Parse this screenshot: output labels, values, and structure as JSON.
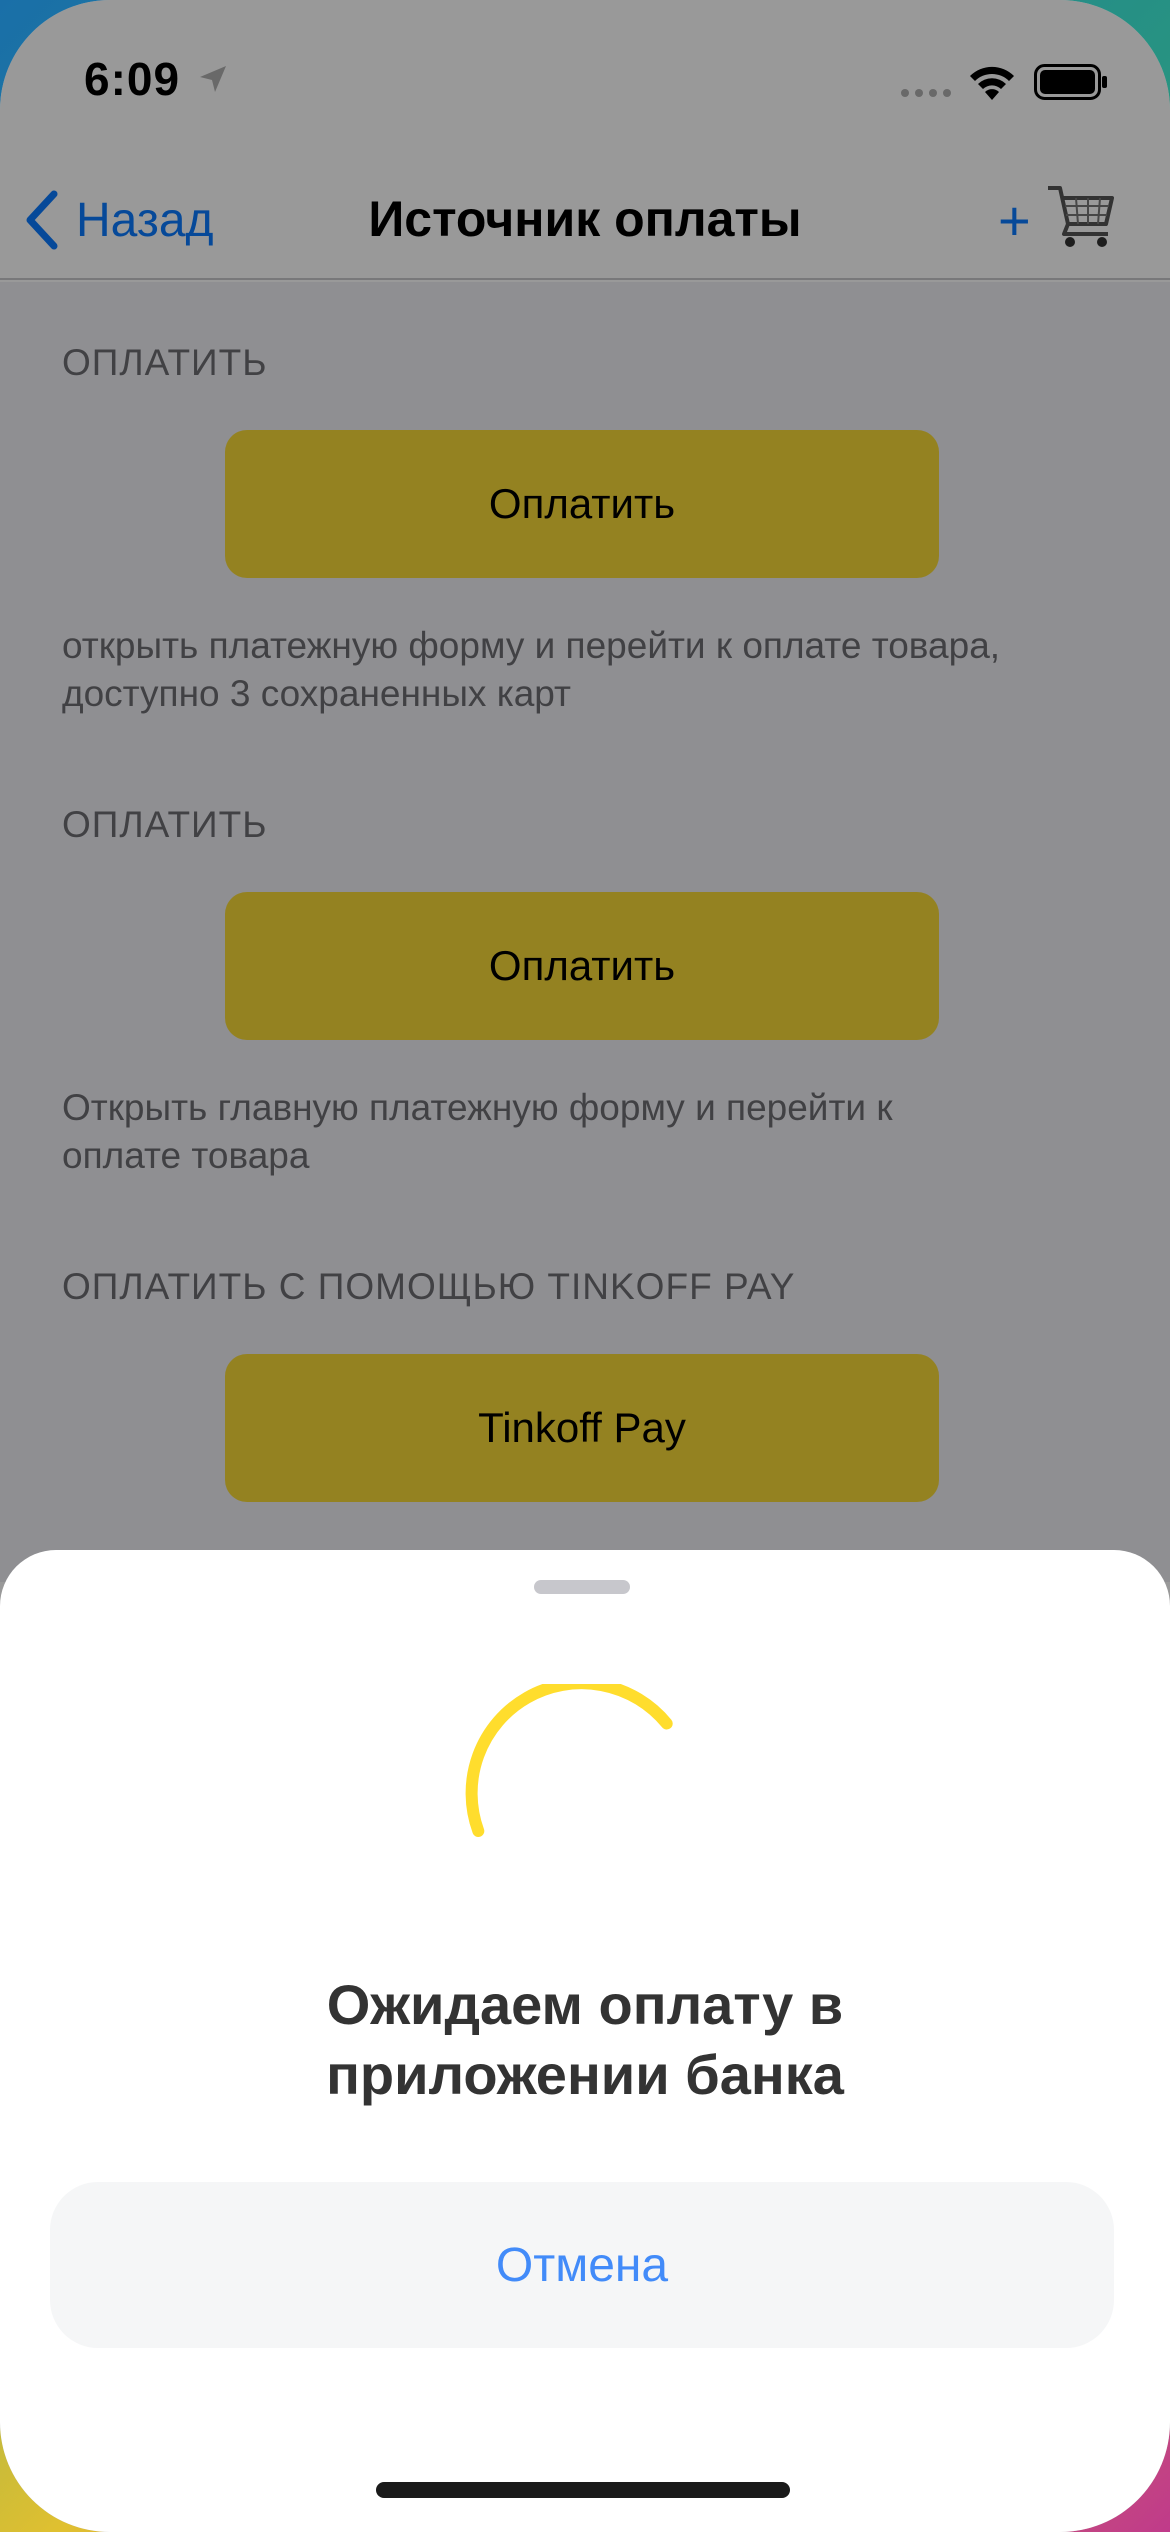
{
  "status_bar": {
    "time": "6:09"
  },
  "nav": {
    "back_label": "Назад",
    "title": "Источник оплаты",
    "plus_label": "+"
  },
  "sections": [
    {
      "header": "ОПЛАТИТЬ",
      "button_label": "Оплатить",
      "footer_line1": "открыть платежную форму и перейти к оплате товара,",
      "footer_line2": "доступно 3 сохраненных карт"
    },
    {
      "header": "ОПЛАТИТЬ",
      "button_label": "Оплатить",
      "footer_line1": "Открыть главную платежную форму и перейти к",
      "footer_line2": "оплате товара"
    },
    {
      "header": "ОПЛАТИТЬ С ПОМОЩЬЮ TINKOFF PAY",
      "button_label": "Tinkoff Pay"
    }
  ],
  "sheet": {
    "title_line1": "Ожидаем оплату в",
    "title_line2": "приложении банка",
    "cancel_label": "Отмена"
  },
  "colors": {
    "accent_blue": "#0a7aff",
    "pay_button_yellow": "#f7d938",
    "spinner_yellow": "#ffdd2d",
    "cancel_text_blue": "#428bf9"
  },
  "icons": {
    "back": "chevron-left-icon",
    "cart": "shopping-cart-icon",
    "location": "location-arrow-icon",
    "wifi": "wifi-icon",
    "battery": "battery-icon",
    "spinner": "loading-spinner-icon"
  }
}
